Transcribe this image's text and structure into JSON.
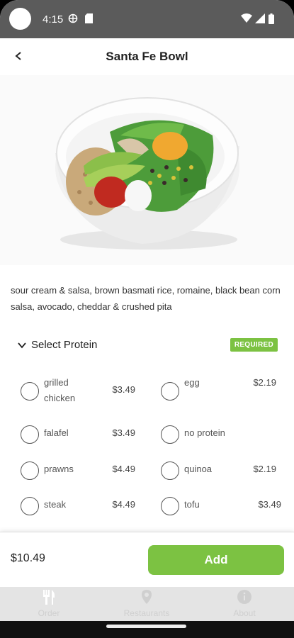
{
  "status": {
    "time": "4:15"
  },
  "header": {
    "title": "Santa Fe Bowl"
  },
  "item": {
    "description": "sour cream & salsa, brown basmati rice, romaine, black bean corn salsa, avocado, cheddar & crushed pita"
  },
  "protein": {
    "heading": "Select Protein",
    "badge": "REQUIRED",
    "options": [
      {
        "name": "grilled chicken",
        "price": "$3.49"
      },
      {
        "name": "egg",
        "price": "$2.19"
      },
      {
        "name": "falafel",
        "price": "$3.49"
      },
      {
        "name": "no protein",
        "price": ""
      },
      {
        "name": "prawns",
        "price": "$4.49"
      },
      {
        "name": "quinoa",
        "price": "$2.19"
      },
      {
        "name": "steak",
        "price": "$4.49"
      },
      {
        "name": "tofu",
        "price": "$3.49"
      }
    ]
  },
  "footer": {
    "total": "$10.49",
    "add_label": "Add"
  },
  "tabs": [
    {
      "label": "Order",
      "icon": "utensils-icon"
    },
    {
      "label": "Restaurants",
      "icon": "location-pin-icon"
    },
    {
      "label": "About",
      "icon": "info-icon"
    }
  ],
  "colors": {
    "accent": "#7cc242",
    "statusbar": "#5b5b5b"
  }
}
